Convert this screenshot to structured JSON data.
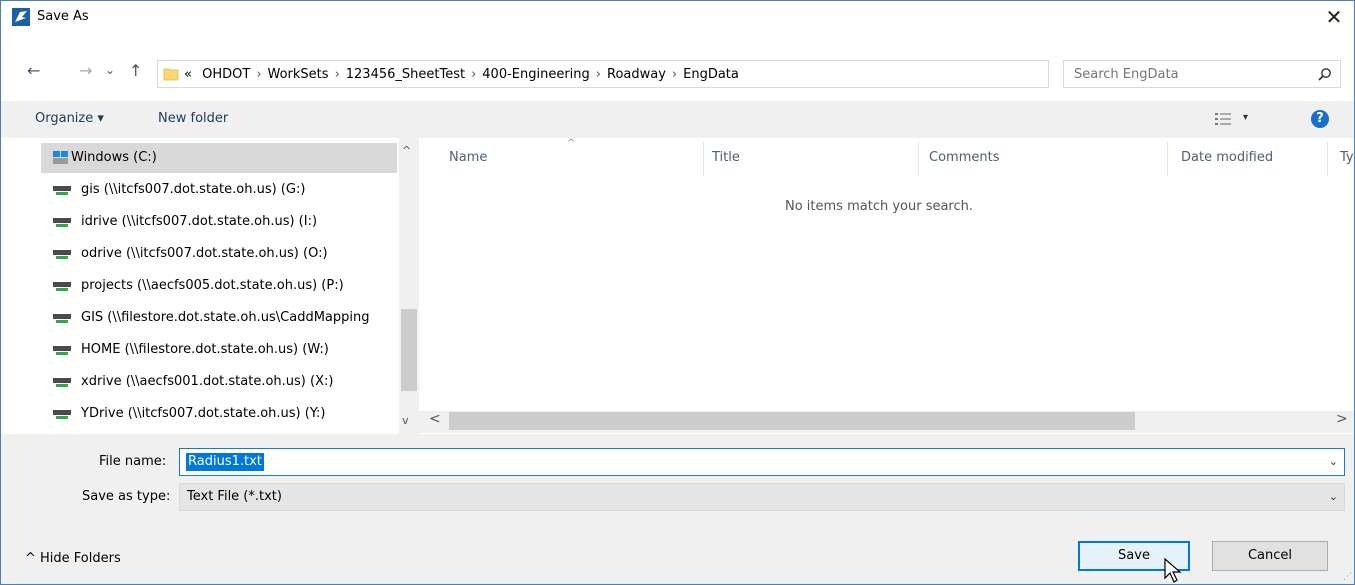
{
  "window": {
    "title": "Save As",
    "close_glyph": "✕",
    "icon": "save-as-app-icon"
  },
  "nav": {
    "back": "←",
    "forward": "→",
    "recent": "⌄",
    "up": "↑"
  },
  "address": {
    "prefix": "«",
    "crumbs": [
      "OHDOT",
      "WorkSets",
      "123456_SheetTest",
      "400-Engineering",
      "Roadway",
      "EngData"
    ],
    "separator": "›",
    "dropdown": "⌄",
    "refresh": "↻"
  },
  "search": {
    "placeholder": "Search EngData"
  },
  "toolbar": {
    "organize": "Organize ▾",
    "new_folder": "New folder",
    "view_dropdown": "▾",
    "help": "?"
  },
  "sidebar": {
    "items": [
      {
        "label": "Windows (C:)",
        "selected": true
      },
      {
        "label": "gis (\\\\itcfs007.dot.state.oh.us) (G:)"
      },
      {
        "label": "idrive (\\\\itcfs007.dot.state.oh.us) (I:)"
      },
      {
        "label": "odrive (\\\\itcfs007.dot.state.oh.us) (O:)"
      },
      {
        "label": "projects (\\\\aecfs005.dot.state.oh.us) (P:)"
      },
      {
        "label": "GIS (\\\\filestore.dot.state.oh.us\\CaddMapping"
      },
      {
        "label": "HOME (\\\\filestore.dot.state.oh.us) (W:)"
      },
      {
        "label": "xdrive (\\\\aecfs001.dot.state.oh.us) (X:)"
      },
      {
        "label": "YDrive (\\\\itcfs007.dot.state.oh.us) (Y:)"
      }
    ],
    "scroll_up": "^",
    "scroll_down": "v"
  },
  "filelist": {
    "columns": [
      "Name",
      "Title",
      "Comments",
      "Date modified",
      "Ty"
    ],
    "sort_caret": "^",
    "empty_message": "No items match your search.",
    "scroll_left": "<",
    "scroll_right": ">"
  },
  "form": {
    "filename_label": "File name:",
    "filename_value": "Radius1.txt",
    "filetype_label": "Save as type:",
    "filetype_value": "Text File (*.txt)",
    "dropdown_glyph": "⌄"
  },
  "footer": {
    "hide_folders": "^  Hide Folders",
    "save": "Save",
    "cancel": "Cancel"
  },
  "colors": {
    "accent": "#0078d7",
    "selection": "#d9d9d9"
  }
}
